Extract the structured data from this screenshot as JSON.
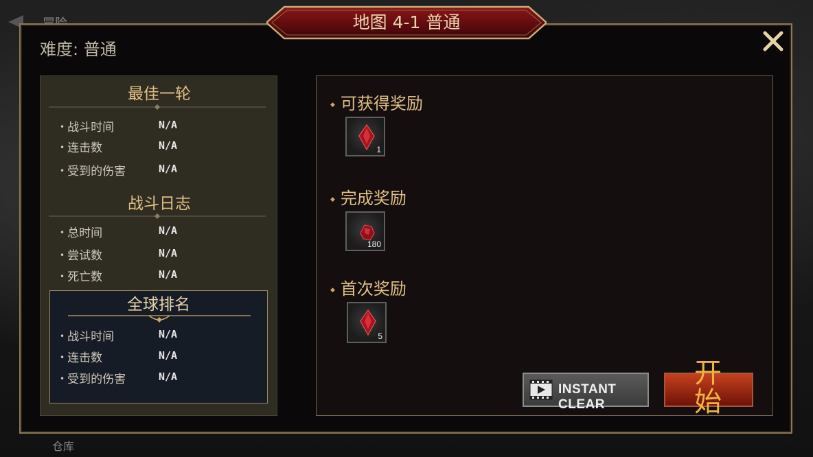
{
  "background": {
    "back_label": "冒险",
    "warehouse_label": "仓库"
  },
  "modal": {
    "title": "地图 4-1 普通",
    "difficulty": "难度: 普通"
  },
  "best_round": {
    "title": "最佳一轮",
    "rows": [
      {
        "label": "战斗时间",
        "value": "N/A"
      },
      {
        "label": "连击数",
        "value": "N/A"
      },
      {
        "label": "受到的伤害",
        "value": "N/A"
      }
    ]
  },
  "battle_log": {
    "title": "战斗日志",
    "rows": [
      {
        "label": "总时间",
        "value": "N/A"
      },
      {
        "label": "尝试数",
        "value": "N/A"
      },
      {
        "label": "死亡数",
        "value": "N/A"
      }
    ]
  },
  "global_rank": {
    "title": "全球排名",
    "rows": [
      {
        "label": "战斗时间",
        "value": "N/A"
      },
      {
        "label": "连击数",
        "value": "N/A"
      },
      {
        "label": "受到的伤害",
        "value": "N/A"
      }
    ]
  },
  "rewards": {
    "available": {
      "title": "可获得奖励",
      "item": {
        "icon": "red-crystal-icon",
        "count": "1"
      }
    },
    "completion": {
      "title": "完成奖励",
      "item": {
        "icon": "red-ore-icon",
        "count": "180"
      }
    },
    "first": {
      "title": "首次奖励",
      "item": {
        "icon": "red-crystal-icon",
        "count": "5"
      }
    }
  },
  "buttons": {
    "instant_clear": "INSTANT CLEAR",
    "start": "开始"
  },
  "colors": {
    "gold": "#e0bf84",
    "start_red": "#c4411e",
    "banner_red": "#6a0e12"
  }
}
